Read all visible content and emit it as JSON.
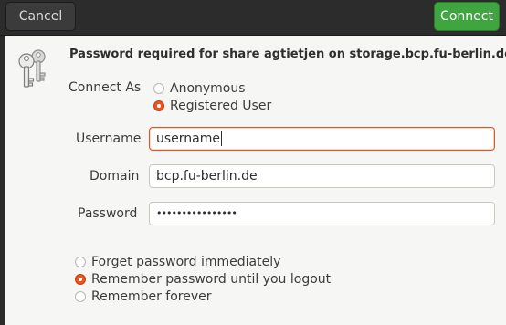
{
  "header": {
    "cancel_label": "Cancel",
    "connect_label": "Connect"
  },
  "icon": "keys-icon",
  "title": "Password required for share agtietjen on storage.bcp.fu-berlin.de",
  "connect_as": {
    "label": "Connect As",
    "options": [
      "Anonymous",
      "Registered User"
    ],
    "selected": "Registered User"
  },
  "fields": {
    "username_label": "Username",
    "username_value": "username",
    "domain_label": "Domain",
    "domain_value": "bcp.fu-berlin.de",
    "password_label": "Password",
    "password_value": "••••••••••••••••"
  },
  "remember": {
    "options": [
      "Forget password immediately",
      "Remember password until you logout",
      "Remember forever"
    ],
    "selected": "Remember password until you logout"
  },
  "colors": {
    "accent": "#e95420",
    "connect": "#3fa53f",
    "headerbar": "#2c2c2c",
    "dialog_bg": "#f6f6f5"
  }
}
